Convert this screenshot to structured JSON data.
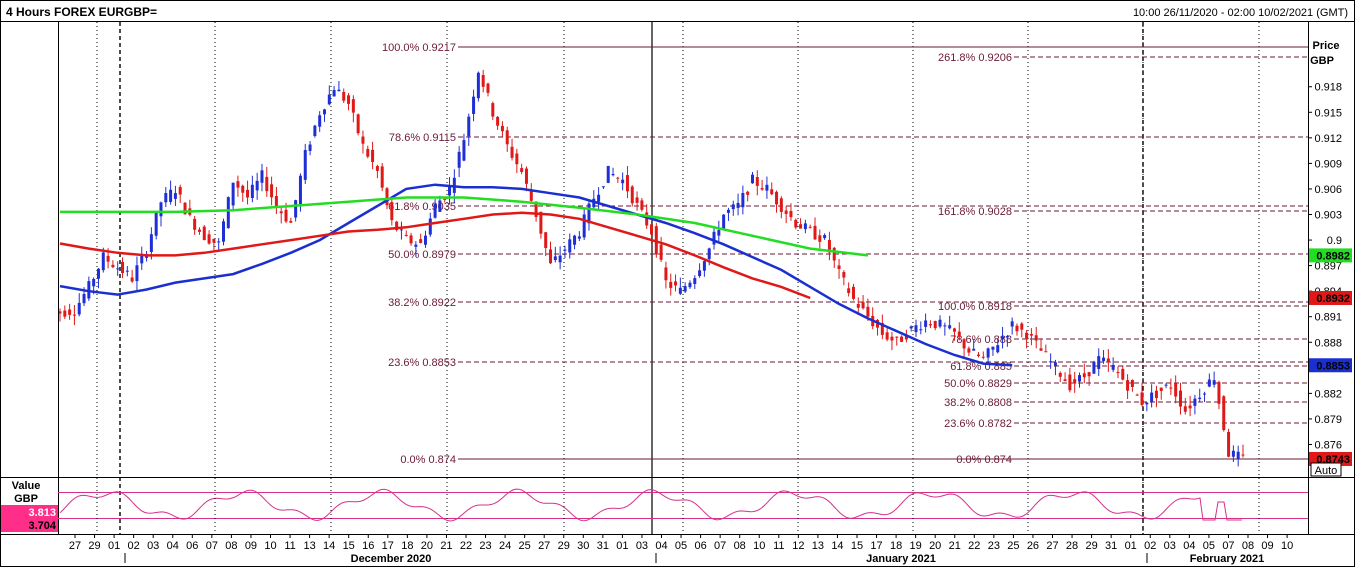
{
  "header": {
    "title": "4 Hours FOREX EURGBP=",
    "range": "10:00 26/11/2020 - 02:00 10/02/2021 (GMT)"
  },
  "price_axis": {
    "title_line1": "Price",
    "title_line2": "GBP",
    "auto_label": "Auto"
  },
  "oscillator_axis": {
    "title_line1": "Value",
    "title_line2": "GBP",
    "value_top": "3.813",
    "value_bottom": "3.704"
  },
  "colors": {
    "up_candle": "#1f2fd6",
    "down_candle": "#e01818",
    "ma_fast": "#1a2fd0",
    "ma_mid": "#e01818",
    "ma_slow": "#22dd22",
    "fib_line": "#6b1b36",
    "oscillator": "#d6308a",
    "osc_badge": "#ff2e88"
  },
  "price_badges": [
    {
      "value": "0.8982",
      "color": "#22dd22",
      "text_color": "#000000"
    },
    {
      "value": "0.8932",
      "color": "#e01818",
      "text_color": "#000000"
    },
    {
      "value": "0.8853",
      "color": "#1a2fd0",
      "text_color": "#000000"
    },
    {
      "value": "0.8743",
      "color": "#e01818",
      "text_color": "#000000"
    }
  ],
  "fib_set_1": [
    {
      "label": "100.0% 0.9217"
    },
    {
      "label": "78.6%  0.9115"
    },
    {
      "label": "61.8%  0.9035"
    },
    {
      "label": "50.0%  0.8979"
    },
    {
      "label": "38.2%  0.8922"
    },
    {
      "label": "23.6%  0.8853"
    },
    {
      "label": "0.0%  0.874"
    }
  ],
  "fib_set_2": [
    {
      "label": "261.8% 0.9206"
    },
    {
      "label": "161.8% 0.9028"
    },
    {
      "label": "100.0% 0.8918"
    },
    {
      "label": "78.6%  0.888"
    },
    {
      "label": "61.8%  0.885"
    },
    {
      "label": "50.0%  0.8829"
    },
    {
      "label": "38.2%  0.8808"
    },
    {
      "label": "23.6%  0.8782"
    },
    {
      "label": "0.0%  0.874"
    }
  ],
  "chart_data": {
    "type": "candlestick",
    "title": "4 Hours FOREX EURGBP=",
    "ylabel": "Price GBP",
    "ylim": [
      0.8723,
      0.9256
    ],
    "yticks": [
      "0.918",
      "0.915",
      "0.912",
      "0.909",
      "0.906",
      "0.903",
      "0.9",
      "0.897",
      "0.894",
      "0.891",
      "0.888",
      "0.885",
      "0.882",
      "0.879",
      "0.876"
    ],
    "ytick_values": [
      0.918,
      0.915,
      0.912,
      0.909,
      0.906,
      0.903,
      0.9,
      0.897,
      0.894,
      0.891,
      0.888,
      0.885,
      0.882,
      0.879,
      0.876
    ],
    "xticks": [
      "27",
      "29",
      "01",
      "02",
      "03",
      "04",
      "06",
      "07",
      "08",
      "09",
      "10",
      "11",
      "13",
      "14",
      "15",
      "16",
      "17",
      "18",
      "20",
      "21",
      "22",
      "23",
      "24",
      "25",
      "27",
      "29",
      "30",
      "31",
      "01",
      "03",
      "04",
      "05",
      "06",
      "07",
      "08",
      "10",
      "11",
      "12",
      "13",
      "14",
      "15",
      "17",
      "18",
      "19",
      "20",
      "21",
      "22",
      "23",
      "25",
      "26",
      "27",
      "28",
      "29",
      "31",
      "01",
      "02",
      "03",
      "04",
      "05",
      "07",
      "08",
      "09",
      "10"
    ],
    "xtick_pos": [
      0.0,
      0.019,
      0.05,
      0.075,
      0.1,
      0.125,
      0.151,
      0.176,
      0.201,
      0.226,
      0.251,
      0.276,
      0.301,
      0.326,
      0.351,
      0.376,
      0.402,
      0.427,
      0.452,
      0.477,
      0.502,
      0.527,
      0.552,
      0.577,
      0.602,
      0.627,
      0.652,
      0.677,
      0.708,
      0.728,
      0.753,
      0.778,
      0.803,
      0.828,
      0.853,
      0.878,
      0.903,
      0.928,
      0.953,
      0.978,
      1.003,
      1.028,
      1.053,
      1.078,
      1.103,
      1.128,
      1.153,
      1.179,
      1.204,
      1.229,
      1.254,
      1.279,
      1.304,
      1.329,
      1.354,
      1.379,
      1.404,
      1.429,
      1.454,
      1.479,
      1.504,
      1.529,
      1.554
    ],
    "month_labels": [
      "December 2020",
      "January 2021",
      "February 2021"
    ],
    "x_start": "2020-11-26",
    "x_end": "2021-02-10",
    "close_series": [
      {
        "d": 0,
        "c": 0.8915
      },
      {
        "d": 1,
        "c": 0.8918
      },
      {
        "d": 2,
        "c": 0.8945
      },
      {
        "d": 3,
        "c": 0.898
      },
      {
        "d": 4,
        "c": 0.8968
      },
      {
        "d": 5,
        "c": 0.8955
      },
      {
        "d": 6,
        "c": 0.899
      },
      {
        "d": 7,
        "c": 0.9045
      },
      {
        "d": 8,
        "c": 0.906
      },
      {
        "d": 9,
        "c": 0.9025
      },
      {
        "d": 10,
        "c": 0.9005
      },
      {
        "d": 11,
        "c": 0.8995
      },
      {
        "d": 12,
        "c": 0.907
      },
      {
        "d": 13,
        "c": 0.905
      },
      {
        "d": 14,
        "c": 0.9075
      },
      {
        "d": 15,
        "c": 0.904
      },
      {
        "d": 16,
        "c": 0.902
      },
      {
        "d": 17,
        "c": 0.91
      },
      {
        "d": 18,
        "c": 0.915
      },
      {
        "d": 19,
        "c": 0.918
      },
      {
        "d": 20,
        "c": 0.916
      },
      {
        "d": 21,
        "c": 0.911
      },
      {
        "d": 22,
        "c": 0.908
      },
      {
        "d": 23,
        "c": 0.902
      },
      {
        "d": 24,
        "c": 0.9
      },
      {
        "d": 25,
        "c": 0.8995
      },
      {
        "d": 26,
        "c": 0.904
      },
      {
        "d": 27,
        "c": 0.906
      },
      {
        "d": 28,
        "c": 0.912
      },
      {
        "d": 29,
        "c": 0.92
      },
      {
        "d": 30,
        "c": 0.915
      },
      {
        "d": 31,
        "c": 0.911
      },
      {
        "d": 32,
        "c": 0.908
      },
      {
        "d": 33,
        "c": 0.903
      },
      {
        "d": 34,
        "c": 0.897
      },
      {
        "d": 35,
        "c": 0.899
      },
      {
        "d": 36,
        "c": 0.901
      },
      {
        "d": 37,
        "c": 0.905
      },
      {
        "d": 38,
        "c": 0.908
      },
      {
        "d": 39,
        "c": 0.907
      },
      {
        "d": 40,
        "c": 0.904
      },
      {
        "d": 41,
        "c": 0.901
      },
      {
        "d": 42,
        "c": 0.895
      },
      {
        "d": 43,
        "c": 0.894
      },
      {
        "d": 44,
        "c": 0.896
      },
      {
        "d": 45,
        "c": 0.899
      },
      {
        "d": 46,
        "c": 0.903
      },
      {
        "d": 47,
        "c": 0.904
      },
      {
        "d": 48,
        "c": 0.907
      },
      {
        "d": 49,
        "c": 0.906
      },
      {
        "d": 50,
        "c": 0.904
      },
      {
        "d": 51,
        "c": 0.902
      },
      {
        "d": 52,
        "c": 0.901
      },
      {
        "d": 53,
        "c": 0.9
      },
      {
        "d": 54,
        "c": 0.896
      },
      {
        "d": 55,
        "c": 0.893
      },
      {
        "d": 56,
        "c": 0.891
      },
      {
        "d": 57,
        "c": 0.889
      },
      {
        "d": 58,
        "c": 0.888
      },
      {
        "d": 59,
        "c": 0.8895
      },
      {
        "d": 60,
        "c": 0.8905
      },
      {
        "d": 61,
        "c": 0.89
      },
      {
        "d": 62,
        "c": 0.889
      },
      {
        "d": 63,
        "c": 0.887
      },
      {
        "d": 64,
        "c": 0.886
      },
      {
        "d": 65,
        "c": 0.888
      },
      {
        "d": 66,
        "c": 0.89
      },
      {
        "d": 67,
        "c": 0.889
      },
      {
        "d": 68,
        "c": 0.887
      },
      {
        "d": 69,
        "c": 0.885
      },
      {
        "d": 70,
        "c": 0.883
      },
      {
        "d": 71,
        "c": 0.884
      },
      {
        "d": 72,
        "c": 0.886
      },
      {
        "d": 73,
        "c": 0.885
      },
      {
        "d": 74,
        "c": 0.883
      },
      {
        "d": 75,
        "c": 0.881
      },
      {
        "d": 76,
        "c": 0.882
      },
      {
        "d": 77,
        "c": 0.883
      },
      {
        "d": 78,
        "c": 0.88
      },
      {
        "d": 79,
        "c": 0.882
      },
      {
        "d": 80,
        "c": 0.884
      },
      {
        "d": 81,
        "c": 0.875
      },
      {
        "d": 82,
        "c": 0.8743
      }
    ],
    "series": [
      {
        "name": "",
        "type": "moving-average",
        "color": "#1a2fd0",
        "values": [
          [
            0,
            0.8946
          ],
          [
            2,
            0.894
          ],
          [
            4,
            0.8936
          ],
          [
            6,
            0.8942
          ],
          [
            8,
            0.895
          ],
          [
            10,
            0.8955
          ],
          [
            12,
            0.896
          ],
          [
            14,
            0.8972
          ],
          [
            16,
            0.8985
          ],
          [
            18,
            0.9
          ],
          [
            20,
            0.902
          ],
          [
            22,
            0.904
          ],
          [
            24,
            0.906
          ],
          [
            26,
            0.9065
          ],
          [
            28,
            0.9062
          ],
          [
            30,
            0.9062
          ],
          [
            32,
            0.906
          ],
          [
            34,
            0.9055
          ],
          [
            36,
            0.905
          ],
          [
            38,
            0.904
          ],
          [
            40,
            0.903
          ],
          [
            42,
            0.902
          ],
          [
            44,
            0.9008
          ],
          [
            46,
            0.8995
          ],
          [
            48,
            0.898
          ],
          [
            50,
            0.8965
          ],
          [
            52,
            0.8945
          ],
          [
            54,
            0.8925
          ],
          [
            56,
            0.8908
          ],
          [
            58,
            0.8893
          ],
          [
            60,
            0.8878
          ],
          [
            62,
            0.8865
          ],
          [
            64,
            0.8855
          ],
          [
            66,
            0.8853
          ]
        ]
      },
      {
        "name": "",
        "type": "moving-average",
        "color": "#e01818",
        "values": [
          [
            0,
            0.8996
          ],
          [
            2,
            0.899
          ],
          [
            4,
            0.8985
          ],
          [
            6,
            0.8982
          ],
          [
            8,
            0.8982
          ],
          [
            10,
            0.8985
          ],
          [
            12,
            0.899
          ],
          [
            14,
            0.8995
          ],
          [
            16,
            0.9
          ],
          [
            18,
            0.9005
          ],
          [
            20,
            0.901
          ],
          [
            22,
            0.9012
          ],
          [
            24,
            0.9015
          ],
          [
            26,
            0.902
          ],
          [
            28,
            0.9025
          ],
          [
            30,
            0.903
          ],
          [
            32,
            0.9032
          ],
          [
            34,
            0.903
          ],
          [
            36,
            0.9025
          ],
          [
            38,
            0.9015
          ],
          [
            40,
            0.9005
          ],
          [
            42,
            0.8995
          ],
          [
            44,
            0.8982
          ],
          [
            46,
            0.8968
          ],
          [
            48,
            0.8955
          ],
          [
            50,
            0.8945
          ],
          [
            52,
            0.8932
          ]
        ]
      },
      {
        "name": "",
        "type": "moving-average",
        "color": "#22dd22",
        "values": [
          [
            0,
            0.9033
          ],
          [
            4,
            0.9033
          ],
          [
            8,
            0.9033
          ],
          [
            12,
            0.9035
          ],
          [
            16,
            0.904
          ],
          [
            20,
            0.9045
          ],
          [
            24,
            0.905
          ],
          [
            28,
            0.905
          ],
          [
            32,
            0.9045
          ],
          [
            36,
            0.9038
          ],
          [
            40,
            0.903
          ],
          [
            44,
            0.902
          ],
          [
            48,
            0.9005
          ],
          [
            52,
            0.899
          ],
          [
            56,
            0.8982
          ]
        ]
      }
    ],
    "oscillator": {
      "name": "Value GBP",
      "upper_line": 3.813,
      "lower_line": 3.704
    }
  }
}
